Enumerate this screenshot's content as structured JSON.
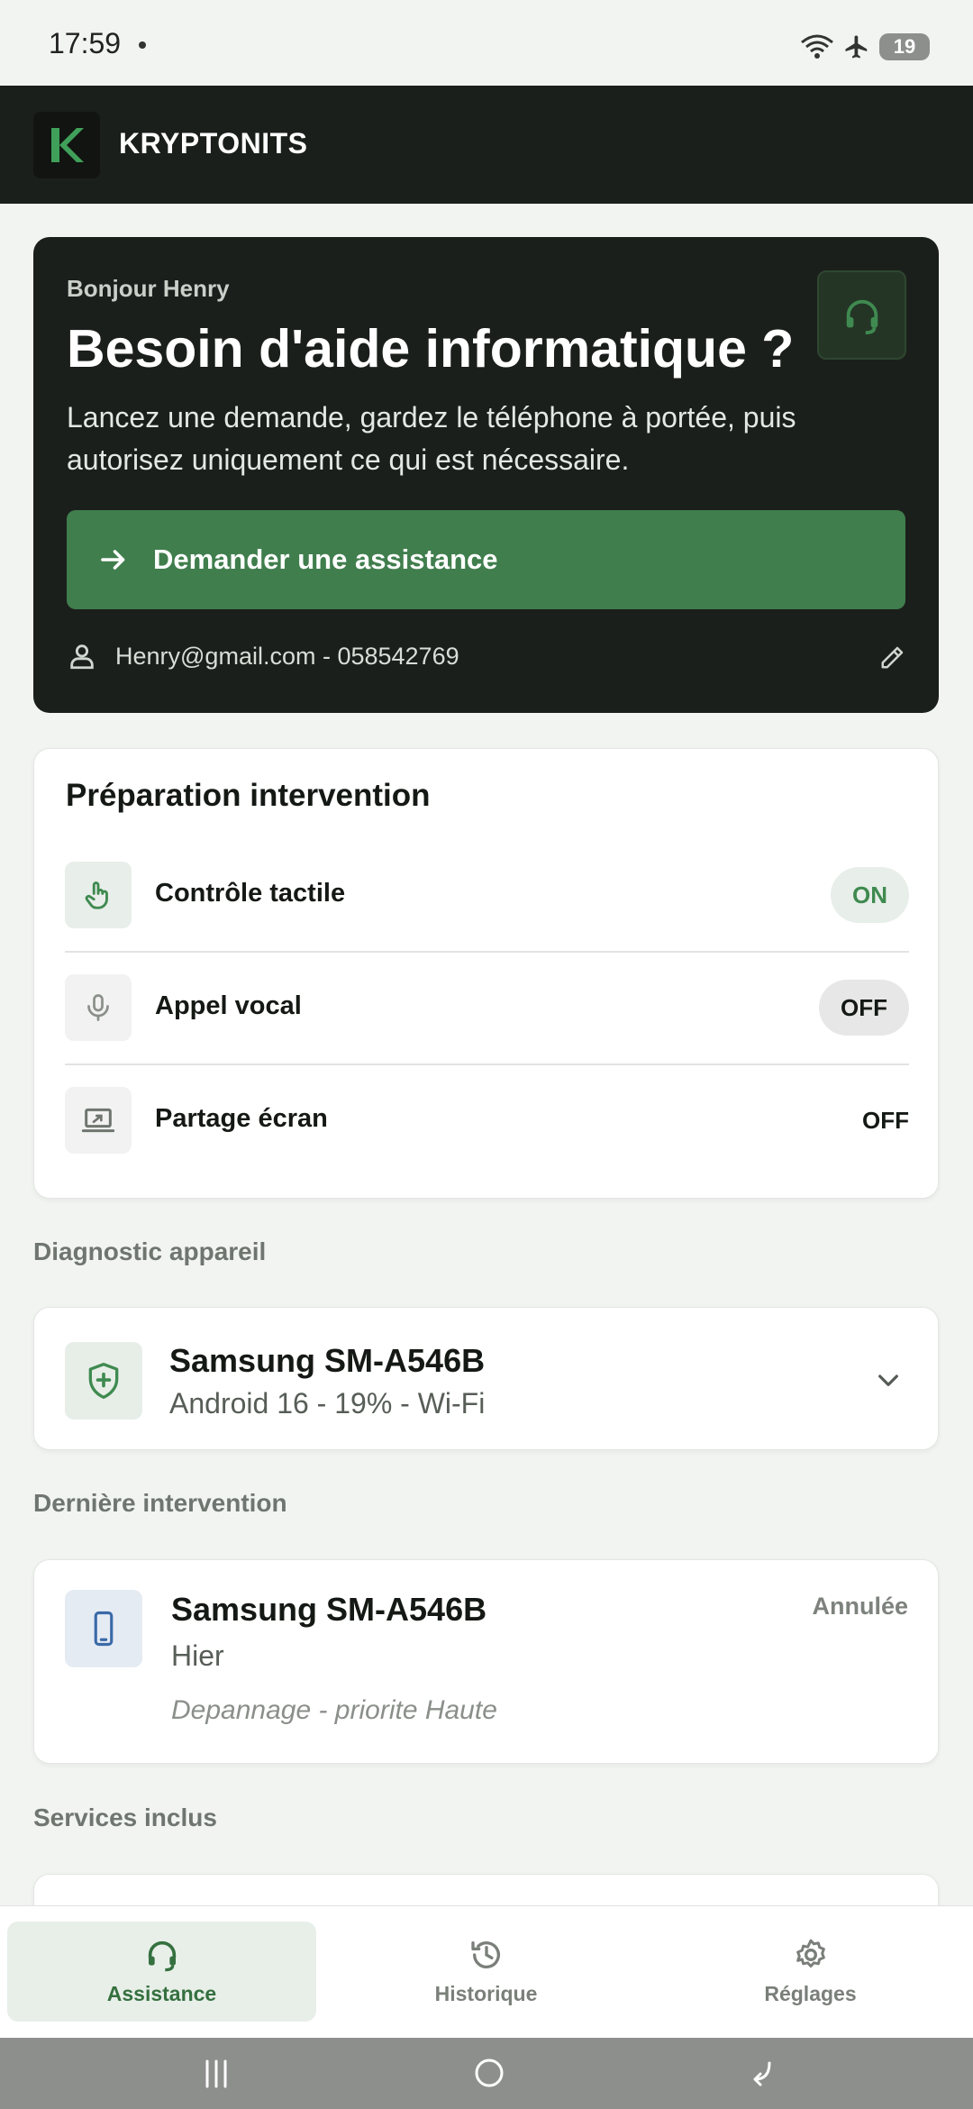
{
  "status_bar": {
    "time": "17:59",
    "battery": "19"
  },
  "app": {
    "title": "KRYPTONITS",
    "logo_letter": "K"
  },
  "hero": {
    "greeting": "Bonjour Henry",
    "title": "Besoin d'aide informatique ?",
    "subtitle": "Lancez une demande, gardez le téléphone à portée, puis autorisez uniquement ce qui est nécessaire.",
    "cta_label": "Demander une assistance",
    "contact": "Henry@gmail.com - 058542769"
  },
  "preparation": {
    "title": "Préparation intervention",
    "rows": [
      {
        "label": "Contrôle tactile",
        "state": "ON"
      },
      {
        "label": "Appel vocal",
        "state": "OFF"
      },
      {
        "label": "Partage écran",
        "state": "OFF"
      }
    ]
  },
  "diagnostic": {
    "section_title": "Diagnostic appareil",
    "device_name": "Samsung SM-A546B",
    "device_info": "Android 16 - 19% - Wi-Fi"
  },
  "last_intervention": {
    "section_title": "Dernière intervention",
    "device_name": "Samsung SM-A546B",
    "date": "Hier",
    "description": "Depannage - priorite Haute",
    "status": "Annulée"
  },
  "services": {
    "section_title": "Services inclus"
  },
  "bottom_nav": {
    "items": [
      {
        "label": "Assistance",
        "icon": "headset-icon",
        "active": true
      },
      {
        "label": "Historique",
        "icon": "history-icon",
        "active": false
      },
      {
        "label": "Réglages",
        "icon": "gear-icon",
        "active": false
      }
    ]
  },
  "colors": {
    "brand_green": "#407e4d",
    "dark_surface": "#1b1f1b",
    "accent_text": "#35703f"
  }
}
